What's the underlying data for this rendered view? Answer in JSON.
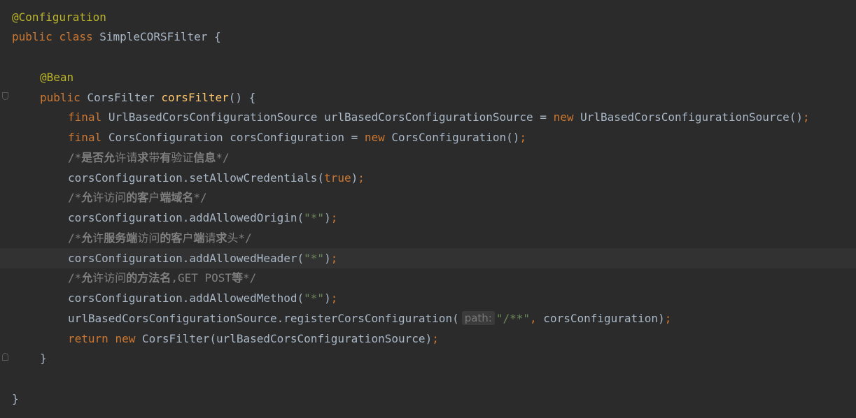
{
  "editor": {
    "lines": {
      "l1": {
        "annotation": "@Configuration"
      },
      "l2": {
        "kw_public": "public",
        "kw_class": "class",
        "class_name": "SimpleCORSFilter",
        "brace": "{"
      },
      "l4": {
        "annotation": "@Bean"
      },
      "l5": {
        "kw_public": "public",
        "type": "CorsFilter",
        "method": "corsFilter",
        "rest": "() {"
      },
      "l6": {
        "kw_final": "final",
        "text_a": "UrlBasedCorsConfigurationSource urlBasedCorsConfigurationSource = ",
        "kw_new": "new",
        "text_b": "UrlBasedCorsConfigurationSource()",
        "semi": ";"
      },
      "l7": {
        "kw_final": "final",
        "text_a": "CorsConfiguration corsConfiguration = ",
        "kw_new": "new",
        "text_b": "CorsConfiguration()",
        "semi": ";"
      },
      "l8": {
        "c1": "/*",
        "c2": "是否允",
        "c3": "许请",
        "c4": "求",
        "c5": "带",
        "c6": "有",
        "c7": "验证",
        "c8": "信息",
        "c9": "*/"
      },
      "l9": {
        "text_a": "corsConfiguration.setAllowCredentials(",
        "kw_true": "true",
        "text_b": ")",
        "semi": ";"
      },
      "l10": {
        "c1": "/*",
        "c2": "允",
        "c3": "许访问",
        "c4": "的客",
        "c5": "户",
        "c6": "端域名",
        "c7": "*/"
      },
      "l11": {
        "text_a": "corsConfiguration.addAllowedOrigin(",
        "str": "\"*\"",
        "text_b": ")",
        "semi": ";"
      },
      "l12": {
        "c1": "/*",
        "c2": "允",
        "c3": "许",
        "c4": "服务端",
        "c5": "访问",
        "c6": "的客",
        "c7": "户",
        "c8": "端",
        "c9": "请",
        "c10": "求",
        "c11": "头",
        "c12": "*/"
      },
      "l13": {
        "text_a": "corsConfiguration.addAllowedHeader(",
        "str": "\"*\"",
        "text_b": ")",
        "semi": ";"
      },
      "l14": {
        "c1": "/*",
        "c2": "允",
        "c3": "许访问",
        "c4": "的方法名",
        "c5": ",GET POST",
        "c6": "等",
        "c7": "*/"
      },
      "l15": {
        "text_a": "corsConfiguration.addAllowedMethod(",
        "str": "\"*\"",
        "text_b": ")",
        "semi": ";"
      },
      "l16": {
        "text_a": "urlBasedCorsConfigurationSource.registerCorsConfiguration(",
        "hint": "path:",
        "str": "\"/**\"",
        "comma": ",",
        "text_b": " corsConfiguration)",
        "semi": ";"
      },
      "l17": {
        "kw_return": "return",
        "kw_new": "new",
        "text_a": "CorsFilter(urlBasedCorsConfigurationSource)",
        "semi": ";"
      },
      "l18": {
        "brace": "}"
      },
      "l20": {
        "brace": "}"
      }
    }
  }
}
